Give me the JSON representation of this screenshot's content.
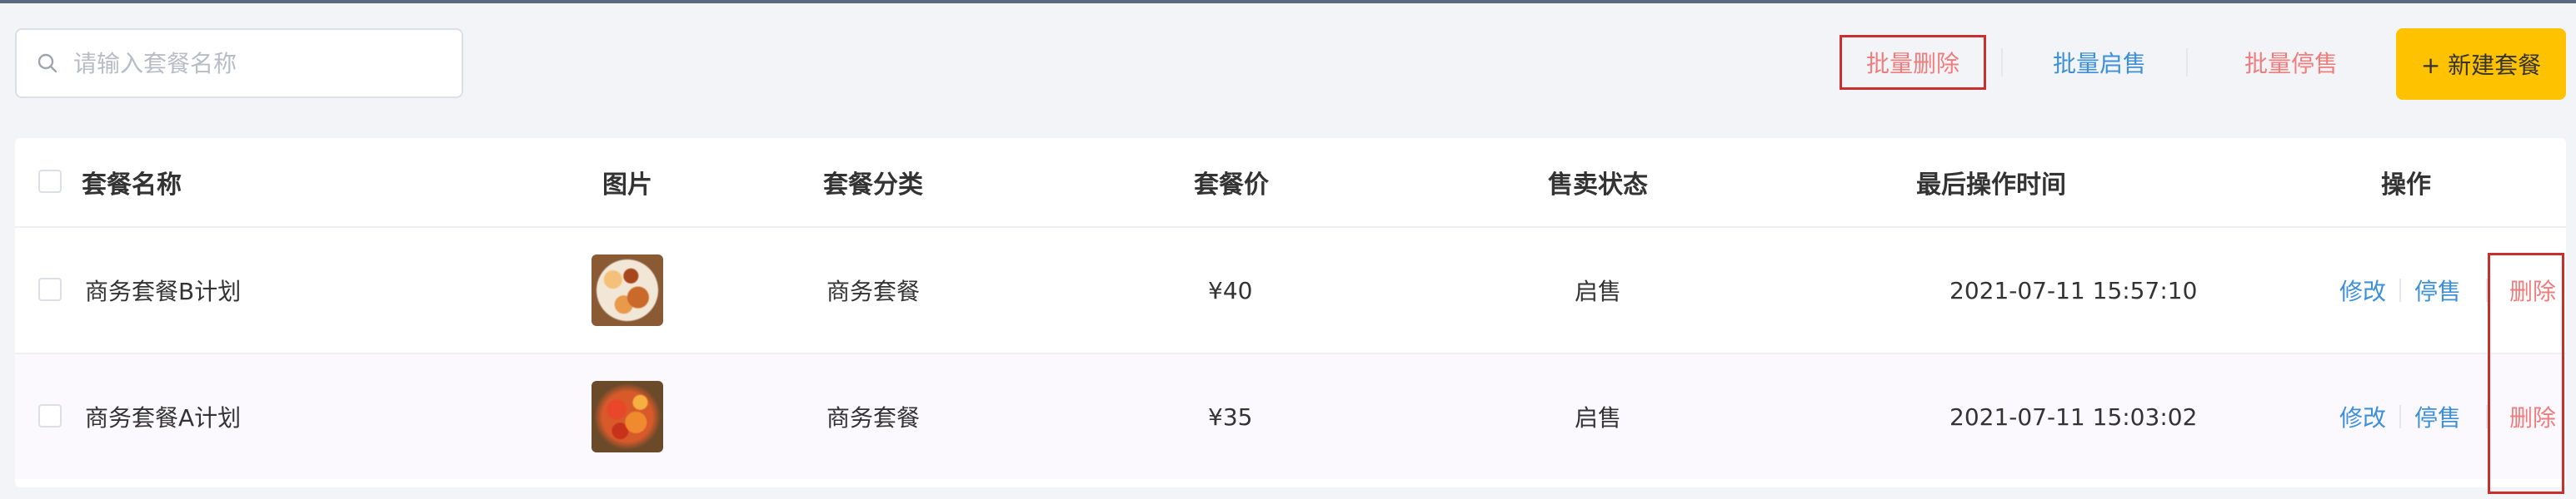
{
  "search": {
    "placeholder": "请输入套餐名称",
    "value": ""
  },
  "toolbar": {
    "batch_delete": "批量删除",
    "batch_enable": "批量启售",
    "batch_disable": "批量停售",
    "new_button": "+ 新建套餐"
  },
  "table": {
    "columns": [
      "套餐名称",
      "图片",
      "套餐分类",
      "套餐价",
      "售卖状态",
      "最后操作时间",
      "操作"
    ],
    "rows": [
      {
        "name": "商务套餐B计划",
        "category": "商务套餐",
        "price": "¥40",
        "status": "启售",
        "updated": "2021-07-11 15:57:10"
      },
      {
        "name": "商务套餐A计划",
        "category": "商务套餐",
        "price": "¥35",
        "status": "启售",
        "updated": "2021-07-11 15:03:02"
      }
    ],
    "actions": {
      "edit": "修改",
      "disable": "停售",
      "delete": "删除"
    }
  },
  "colors": {
    "accent": "#ffc200",
    "link": "#3d8fd8",
    "danger": "#f07c7c",
    "highlight": "#c9302c"
  }
}
